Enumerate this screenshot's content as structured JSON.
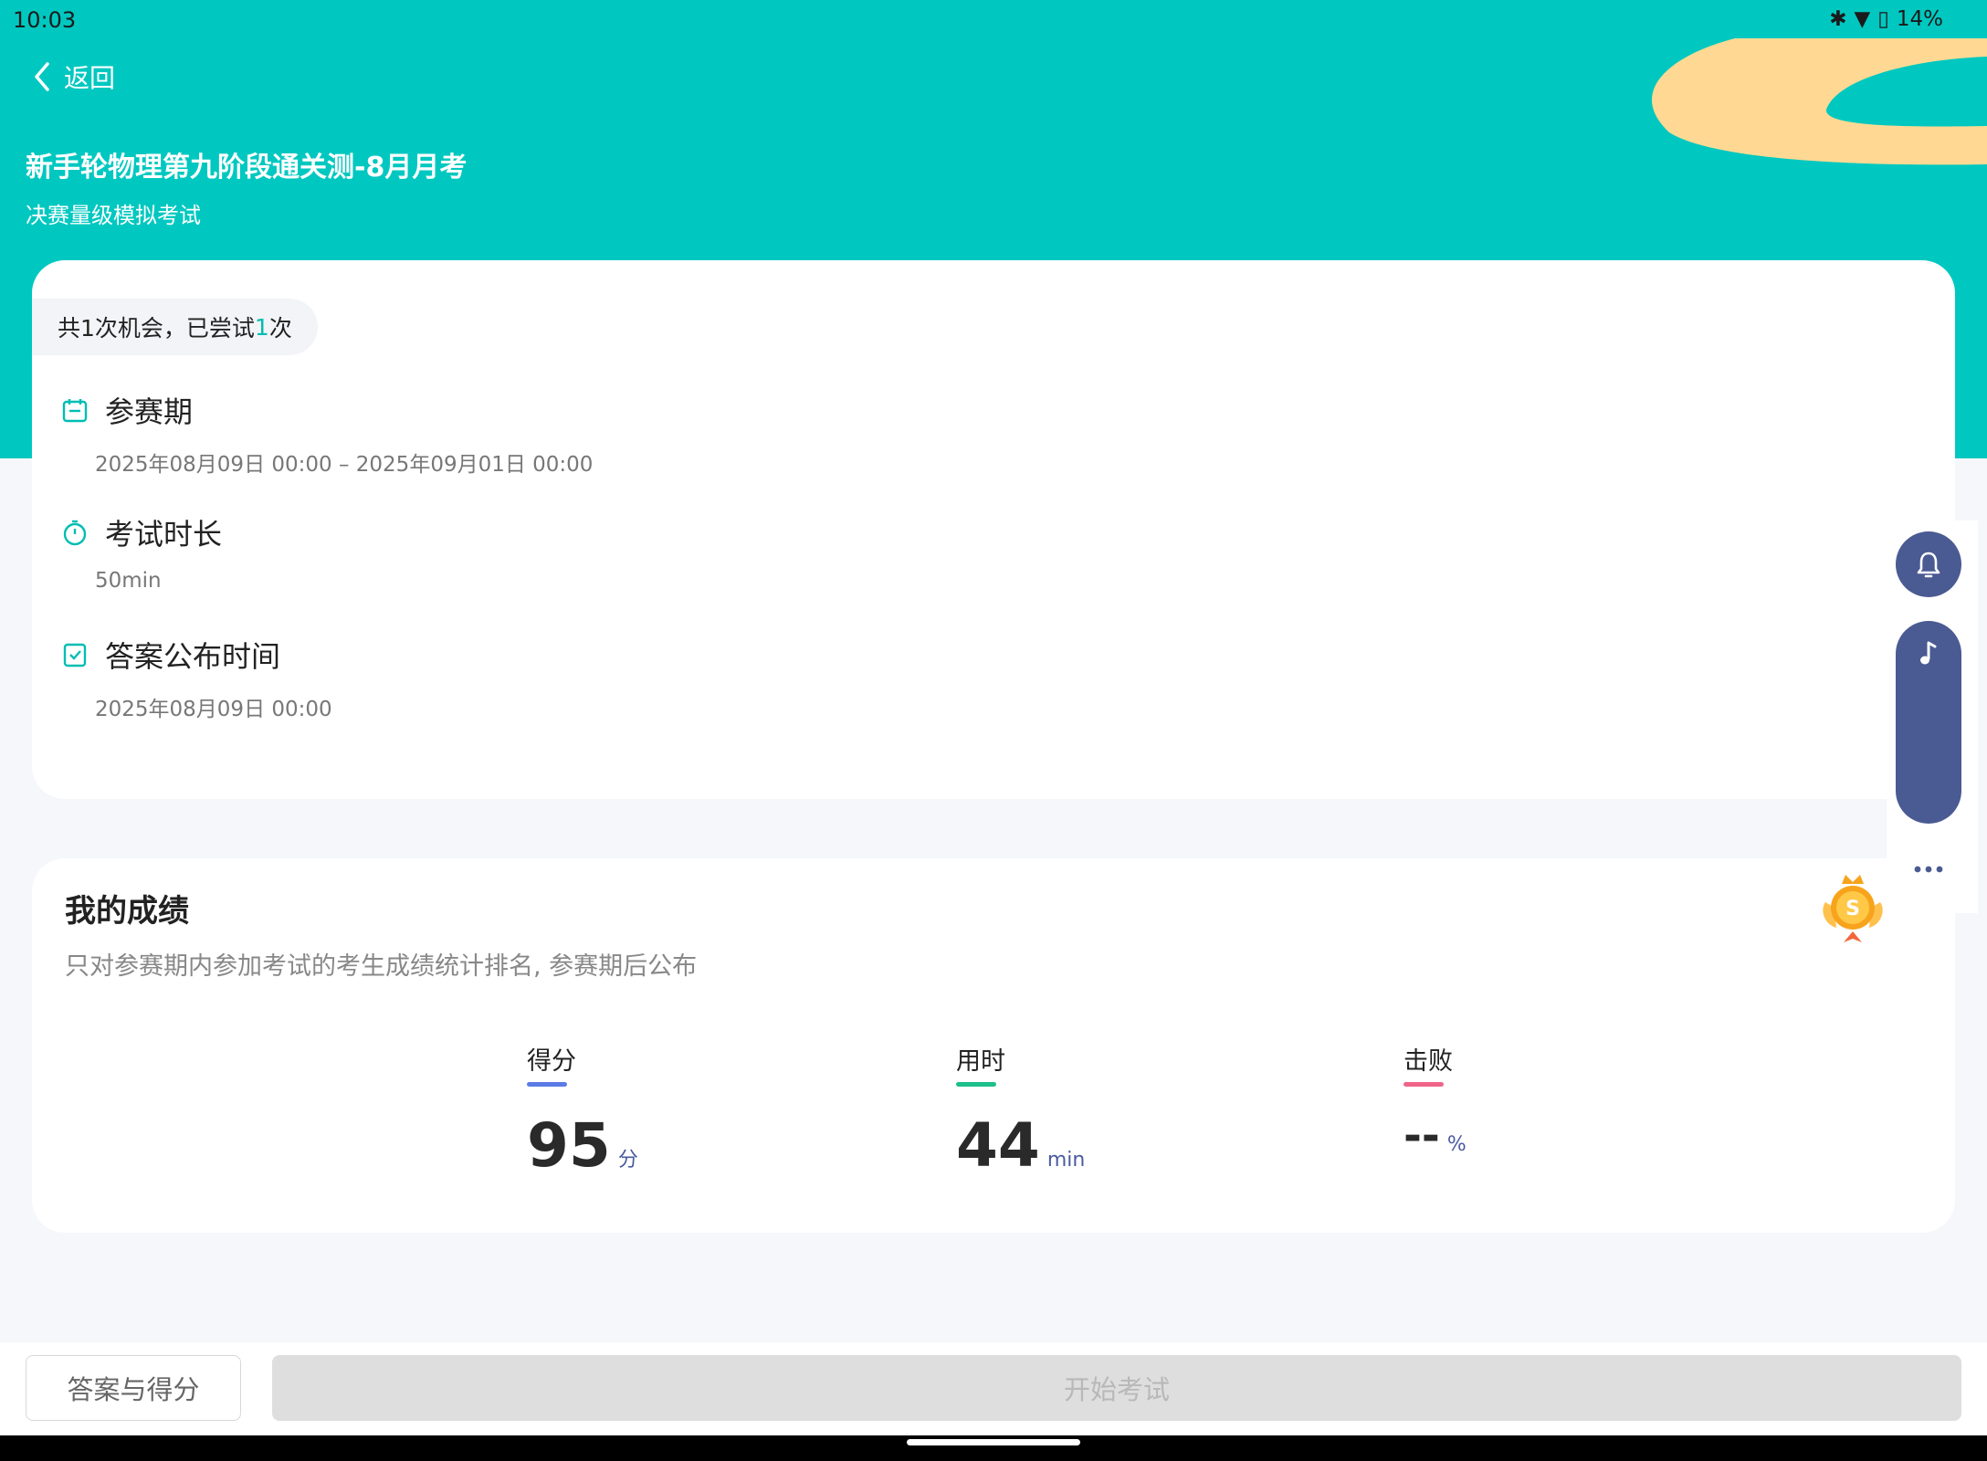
{
  "status": {
    "time": "10:03",
    "battery": "14%"
  },
  "header": {
    "back_label": "返回",
    "title": "新手轮物理第九阶段通关测-8月月考",
    "subtitle": "决赛量级模拟考试"
  },
  "attempts": {
    "prefix": "共1次机会，已尝试",
    "count": "1",
    "suffix": "次"
  },
  "info": {
    "period": {
      "label": "参赛期",
      "value": "2025年08月09日 00:00  –  2025年09月01日 00:00"
    },
    "duration": {
      "label": "考试时长",
      "value": "50min"
    },
    "answer_time": {
      "label": "答案公布时间",
      "value": "2025年08月09日 00:00"
    }
  },
  "score_card": {
    "title": "我的成绩",
    "desc": "只对参赛期内参加考试的考生成绩统计排名, 参赛期后公布",
    "stats": [
      {
        "label": "得分",
        "value": "95",
        "unit": "分",
        "color": "#5b7be6"
      },
      {
        "label": "用时",
        "value": "44",
        "unit": "min",
        "color": "#1dbf8a"
      },
      {
        "label": "击败",
        "value": "--",
        "unit": "%",
        "color": "#f0648a"
      }
    ]
  },
  "buttons": {
    "answer": "答案与得分",
    "start": "开始考试"
  },
  "colors": {
    "accent": "#00c8c0",
    "float": "#4a5a92",
    "sand": "#ffd993"
  }
}
